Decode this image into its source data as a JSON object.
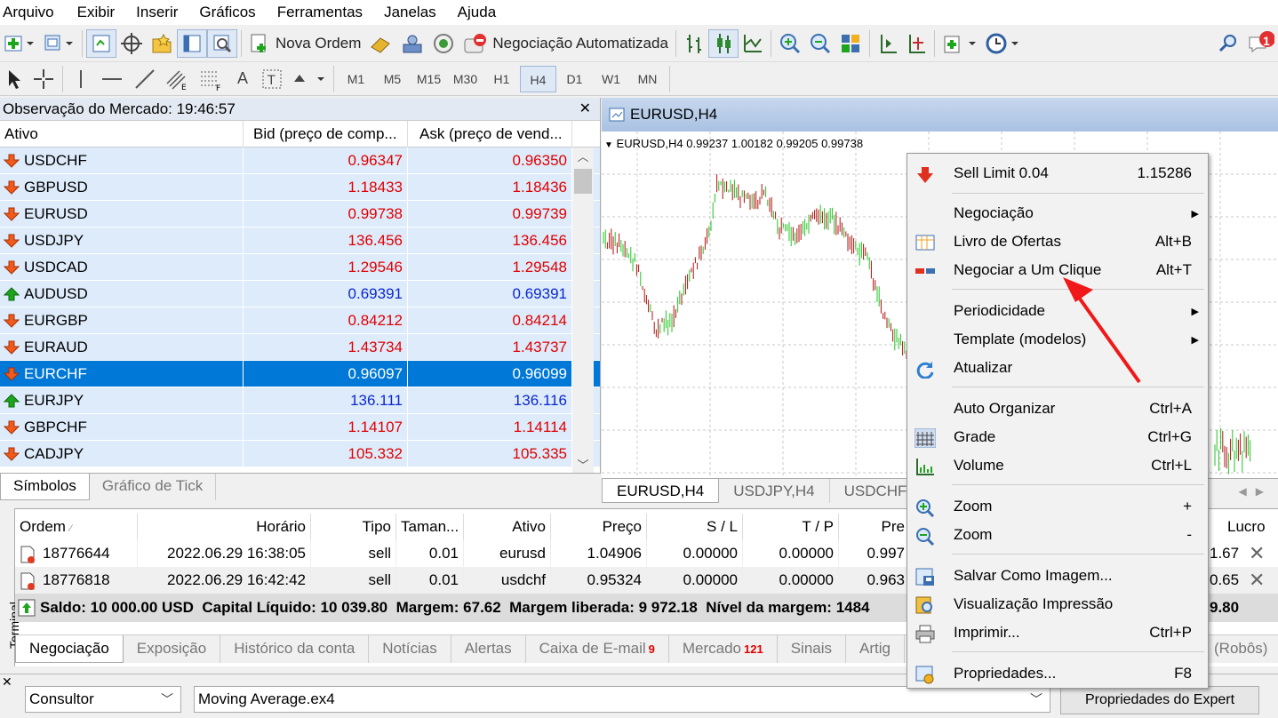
{
  "menubar": [
    "Arquivo",
    "Exibir",
    "Inserir",
    "Gráficos",
    "Ferramentas",
    "Janelas",
    "Ajuda"
  ],
  "toolbar": {
    "new_order": "Nova Ordem",
    "auto_trading": "Negociação Automatizada",
    "notification_count": "1",
    "periods": [
      "M1",
      "M5",
      "M15",
      "M30",
      "H1",
      "H4",
      "D1",
      "W1",
      "MN"
    ],
    "active_period": "H4"
  },
  "market_watch": {
    "title": "Observação do Mercado: 19:46:57",
    "col_symbol": "Ativo",
    "col_bid": "Bid (preço de comp...",
    "col_ask": "Ask (preço de vend...",
    "rows": [
      {
        "symbol": "USDCHF",
        "bid": "0.96347",
        "ask": "0.96350",
        "dir": "down"
      },
      {
        "symbol": "GBPUSD",
        "bid": "1.18433",
        "ask": "1.18436",
        "dir": "down"
      },
      {
        "symbol": "EURUSD",
        "bid": "0.99738",
        "ask": "0.99739",
        "dir": "down"
      },
      {
        "symbol": "USDJPY",
        "bid": "136.456",
        "ask": "136.456",
        "dir": "down"
      },
      {
        "symbol": "USDCAD",
        "bid": "1.29546",
        "ask": "1.29548",
        "dir": "down"
      },
      {
        "symbol": "AUDUSD",
        "bid": "0.69391",
        "ask": "0.69391",
        "dir": "up"
      },
      {
        "symbol": "EURGBP",
        "bid": "0.84212",
        "ask": "0.84214",
        "dir": "down"
      },
      {
        "symbol": "EURAUD",
        "bid": "1.43734",
        "ask": "1.43737",
        "dir": "down"
      },
      {
        "symbol": "EURCHF",
        "bid": "0.96097",
        "ask": "0.96099",
        "dir": "down",
        "selected": true
      },
      {
        "symbol": "EURJPY",
        "bid": "136.111",
        "ask": "136.116",
        "dir": "up"
      },
      {
        "symbol": "GBPCHF",
        "bid": "1.14107",
        "ask": "1.14114",
        "dir": "down"
      },
      {
        "symbol": "CADJPY",
        "bid": "105.332",
        "ask": "105.335",
        "dir": "down"
      }
    ],
    "tabs": [
      "Símbolos",
      "Gráfico de Tick"
    ]
  },
  "chart": {
    "title": "EURUSD,H4",
    "info": "EURUSD,H4  0.99237 1.00182 0.99205 0.99738",
    "tabs": [
      "EURUSD,H4",
      "USDJPY,H4",
      "USDCHF,("
    ],
    "colors": {
      "up": "#22c422",
      "down": "#b01010",
      "grid": "#c8c8c8"
    }
  },
  "terminal": {
    "side_label": "Terminal",
    "headers": [
      "Ordem",
      "Horário",
      "Tipo",
      "Taman...",
      "Ativo",
      "Preço",
      "S / L",
      "T / P",
      "Pre",
      "Lucro"
    ],
    "orders": [
      {
        "id": "18776644",
        "time": "2022.06.29 16:38:05",
        "type": "sell",
        "size": "0.01",
        "symbol": "eurusd",
        "price": "1.04906",
        "sl": "0.00000",
        "tp": "0.00000",
        "cur": "0.997",
        "profit": "1.67"
      },
      {
        "id": "18776818",
        "time": "2022.06.29 16:42:42",
        "type": "sell",
        "size": "0.01",
        "symbol": "usdchf",
        "price": "0.95324",
        "sl": "0.00000",
        "tp": "0.00000",
        "cur": "0.963",
        "profit": "0.65"
      }
    ],
    "summary": "Saldo: 10 000.00 USD  Capital Líquido: 10 039.80  Margem: 67.62  Margem liberada: 9 972.18  Nível da margem: 1484",
    "summary_profit": "9.80",
    "tabs": [
      {
        "label": "Negociação",
        "count": ""
      },
      {
        "label": "Exposição",
        "count": ""
      },
      {
        "label": "Histórico da conta",
        "count": ""
      },
      {
        "label": "Notícias",
        "count": ""
      },
      {
        "label": "Alertas",
        "count": ""
      },
      {
        "label": "Caixa de E-mail",
        "count": "9"
      },
      {
        "label": "Mercado",
        "count": "121"
      },
      {
        "label": "Sinais",
        "count": ""
      },
      {
        "label": "Artig",
        "count": ""
      }
    ],
    "tab_tail": "(Robôs)"
  },
  "tester": {
    "mode": "Consultor",
    "expert": "Moving Average.ex4",
    "props_button": "Propriedades do Expert"
  },
  "context_menu": {
    "items": [
      {
        "label": "Sell Limit 0.04",
        "shortcut": "1.15286",
        "icon": "sell-limit-icon"
      },
      {
        "label": "Negociação",
        "submenu": true
      },
      {
        "label": "Livro de Ofertas",
        "shortcut": "Alt+B",
        "icon": "order-book-icon"
      },
      {
        "label": "Negociar a Um Clique",
        "shortcut": "Alt+T",
        "icon": "one-click-icon"
      },
      {
        "label": "Periodicidade",
        "submenu": true
      },
      {
        "label": "Template (modelos)",
        "submenu": true
      },
      {
        "label": "Atualizar",
        "icon": "refresh-icon"
      },
      {
        "label": "Auto Organizar",
        "shortcut": "Ctrl+A"
      },
      {
        "label": "Grade",
        "shortcut": "Ctrl+G",
        "icon": "grid-icon"
      },
      {
        "label": "Volume",
        "shortcut": "Ctrl+L",
        "icon": "volume-icon"
      },
      {
        "label": "Zoom",
        "shortcut": "+",
        "icon": "zoom-in-icon"
      },
      {
        "label": "Zoom",
        "shortcut": "-",
        "icon": "zoom-out-icon"
      },
      {
        "label": "Salvar Como Imagem...",
        "icon": "save-image-icon"
      },
      {
        "label": "Visualização Impressão",
        "icon": "print-preview-icon"
      },
      {
        "label": "Imprimir...",
        "shortcut": "Ctrl+P",
        "icon": "print-icon"
      },
      {
        "label": "Propriedades...",
        "shortcut": "F8",
        "icon": "properties-icon"
      }
    ]
  }
}
